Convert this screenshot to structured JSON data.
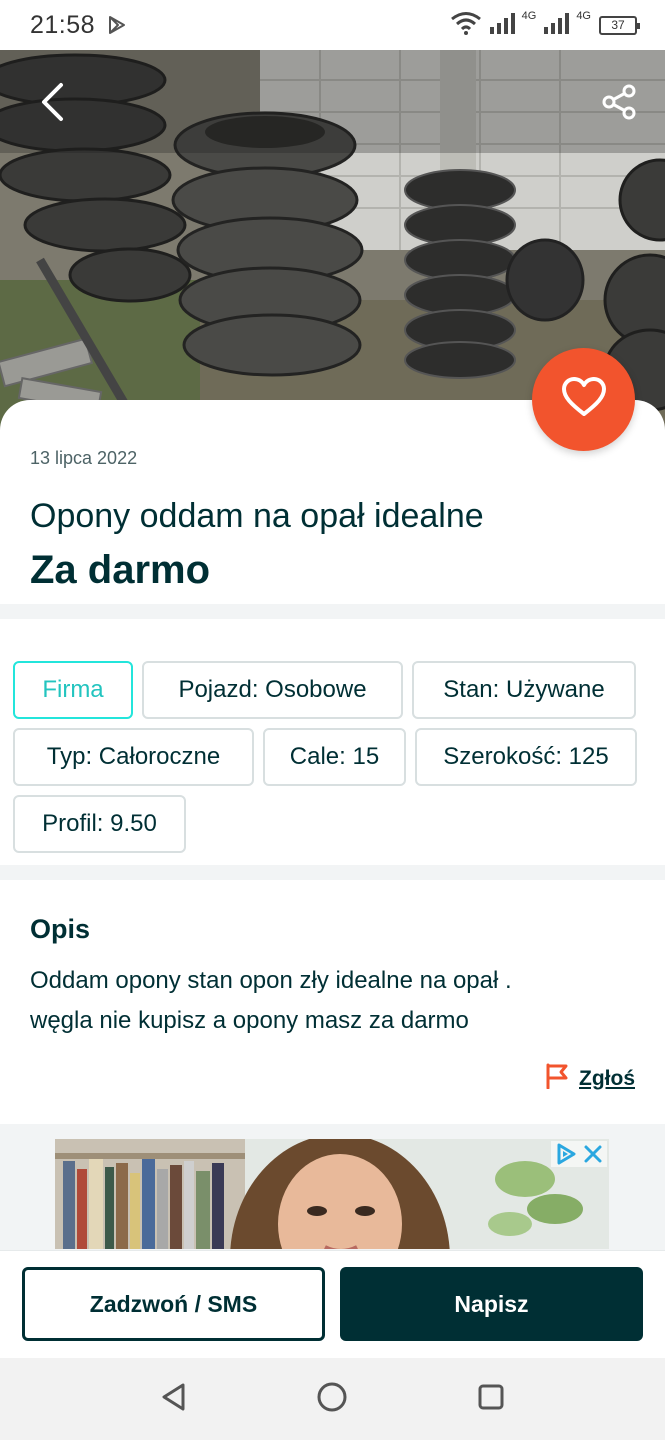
{
  "status_bar": {
    "time": "21:58",
    "network_1": "4G",
    "network_2": "4G",
    "battery": "37"
  },
  "header": {
    "back_icon": "chevron-left-icon",
    "share_icon": "share-icon",
    "favorite_icon": "heart-icon"
  },
  "listing": {
    "date": "13 lipca 2022",
    "title": "Opony oddam na opał idealne",
    "price": "Za darmo"
  },
  "params": [
    {
      "label": "Firma"
    },
    {
      "label": "Pojazd: Osobowe"
    },
    {
      "label": "Stan: Używane"
    },
    {
      "label": "Typ: Całoroczne"
    },
    {
      "label": "Cale: 15"
    },
    {
      "label": "Szerokość: 125"
    },
    {
      "label": "Profil: 9.50"
    }
  ],
  "description": {
    "heading": "Opis",
    "line1": "Oddam opony stan opon zły idealne na opał .",
    "line2": "węgla nie kupisz a opony masz za darmo",
    "report_label": "Zgłoś"
  },
  "actions": {
    "call_label": "Zadzwoń / SMS",
    "write_label": "Napisz"
  },
  "colors": {
    "primary": "#002f34",
    "accent_teal": "#23e5db",
    "favorite_orange": "#f2542d",
    "report_red": "#f2542d"
  }
}
